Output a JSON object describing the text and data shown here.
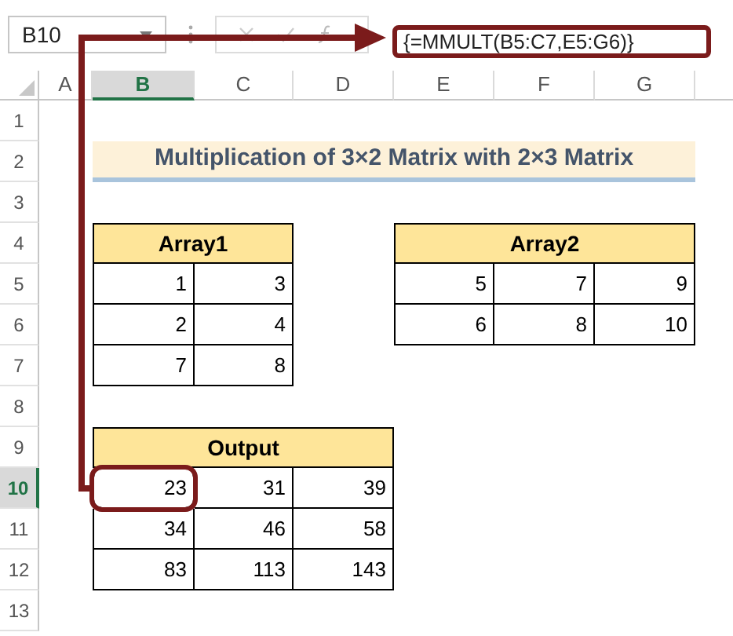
{
  "formula_bar": {
    "name_box": "B10",
    "formula": "{=MMULT(B5:C7,E5:G6)}"
  },
  "column_headers": [
    {
      "label": "A",
      "selected": false
    },
    {
      "label": "B",
      "selected": true
    },
    {
      "label": "C",
      "selected": false
    },
    {
      "label": "D",
      "selected": false
    },
    {
      "label": "E",
      "selected": false
    },
    {
      "label": "F",
      "selected": false
    },
    {
      "label": "G",
      "selected": false
    }
  ],
  "row_headers": [
    {
      "label": "1",
      "selected": false
    },
    {
      "label": "2",
      "selected": false
    },
    {
      "label": "3",
      "selected": false
    },
    {
      "label": "4",
      "selected": false
    },
    {
      "label": "5",
      "selected": false
    },
    {
      "label": "6",
      "selected": false
    },
    {
      "label": "7",
      "selected": false
    },
    {
      "label": "8",
      "selected": false
    },
    {
      "label": "9",
      "selected": false
    },
    {
      "label": "10",
      "selected": true
    },
    {
      "label": "11",
      "selected": false
    },
    {
      "label": "12",
      "selected": false
    },
    {
      "label": "13",
      "selected": false
    }
  ],
  "title": "Multiplication of 3×2 Matrix with 2×3 Matrix",
  "tables": [
    {
      "title": "Array1",
      "rows": [
        [
          {
            "value": "1",
            "selected": false
          },
          {
            "value": "3",
            "selected": false
          }
        ],
        [
          {
            "value": "2",
            "selected": false
          },
          {
            "value": "4",
            "selected": false
          }
        ],
        [
          {
            "value": "7",
            "selected": false
          },
          {
            "value": "8",
            "selected": false
          }
        ]
      ]
    },
    {
      "title": "Array2",
      "rows": [
        [
          {
            "value": "5",
            "selected": false
          },
          {
            "value": "7",
            "selected": false
          },
          {
            "value": "9",
            "selected": false
          }
        ],
        [
          {
            "value": "6",
            "selected": false
          },
          {
            "value": "8",
            "selected": false
          },
          {
            "value": "10",
            "selected": false
          }
        ]
      ]
    },
    {
      "title": "Output",
      "rows": [
        [
          {
            "value": "23",
            "selected": true
          },
          {
            "value": "31",
            "selected": false
          },
          {
            "value": "39",
            "selected": false
          }
        ],
        [
          {
            "value": "34",
            "selected": false
          },
          {
            "value": "46",
            "selected": false
          },
          {
            "value": "58",
            "selected": false
          }
        ],
        [
          {
            "value": "83",
            "selected": false
          },
          {
            "value": "113",
            "selected": false
          },
          {
            "value": "143",
            "selected": false
          }
        ]
      ]
    }
  ]
}
